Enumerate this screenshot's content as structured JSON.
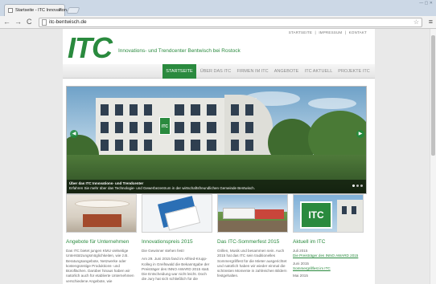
{
  "browser": {
    "tab_title": "Startseite - ITC Innovation...",
    "tab_close": "×",
    "window_controls": "— ▢ ✕",
    "url": "itc-bentwisch.de",
    "back": "←",
    "forward": "→",
    "reload": "C",
    "star": "☆",
    "menu": "≡"
  },
  "site": {
    "top_links": [
      "STARTSEITE",
      "IMPRESSUM",
      "KONTAKT"
    ],
    "top_sep": "|",
    "logo": "ITC",
    "tagline": "Innovations- und Trendcenter Bentwisch bei Rostock",
    "brand_color": "#2a8a3e"
  },
  "nav": {
    "items": [
      {
        "label": "STARTSEITE"
      },
      {
        "label": "ÜBER DAS ITC"
      },
      {
        "label": "FIRMEN IM ITC"
      },
      {
        "label": "ANGEBOTE"
      },
      {
        "label": "ITC AKTUELL"
      },
      {
        "label": "PROJEKTE ITC"
      }
    ]
  },
  "hero": {
    "prev": "◀",
    "next": "▶",
    "sign": "ITC",
    "caption_title": "Über das ITC Innovations- und Trendcenter",
    "caption_text": "Erfahren Sie mehr über das Technologie- und Gewerbezentrum in der wirtschaftsfreundlichen Gemeinde Bentwisch."
  },
  "columns": [
    {
      "title": "Angebote für Unternehmen",
      "paragraphs": [
        "Das ITC bietet jungen KMU vielseitige Unterstützungsmöglichkeiten, wie z.B. Beratungsangebote, Netzwerke oder kostengünstige Produktions- und Büroflächen. Darüber hinaus haben wir natürlich auch für etablierte Unternehmen verschiedene Angebote, wie"
      ]
    },
    {
      "title": "Innovationspreis 2015",
      "paragraphs": [
        "Die Gewinner stehen fest!",
        "Am 29. Juni 2015 fand im Alfried-Krupp-Kolleg in Greifswald die Bekanntgabe der Preisträger des INNO AWARD 2015 statt. Die Entscheidung war nicht leicht. Doch die Jury hat sich schließlich für die"
      ]
    },
    {
      "title": "Das ITC-Sommerfest 2015",
      "paragraphs": [
        "Grillen, Musik und besammen sein. Auch 2015 hat das ITC sein traditionelles Sommergrillfest für die Mieter ausgerichtet und natürlich haben wir wieder einmal die schönsten Momente in zahlreichen Bildern festgehalten."
      ]
    },
    {
      "title": "Aktuell im ITC",
      "news": [
        {
          "date": "Juli 2015",
          "link": "Die Preisträger des INNO AWARD 2015"
        },
        {
          "date": "Juni 2015",
          "link": "Sommergrillfest im ITC"
        },
        {
          "date": "Mai 2015",
          "link": ""
        }
      ]
    }
  ]
}
